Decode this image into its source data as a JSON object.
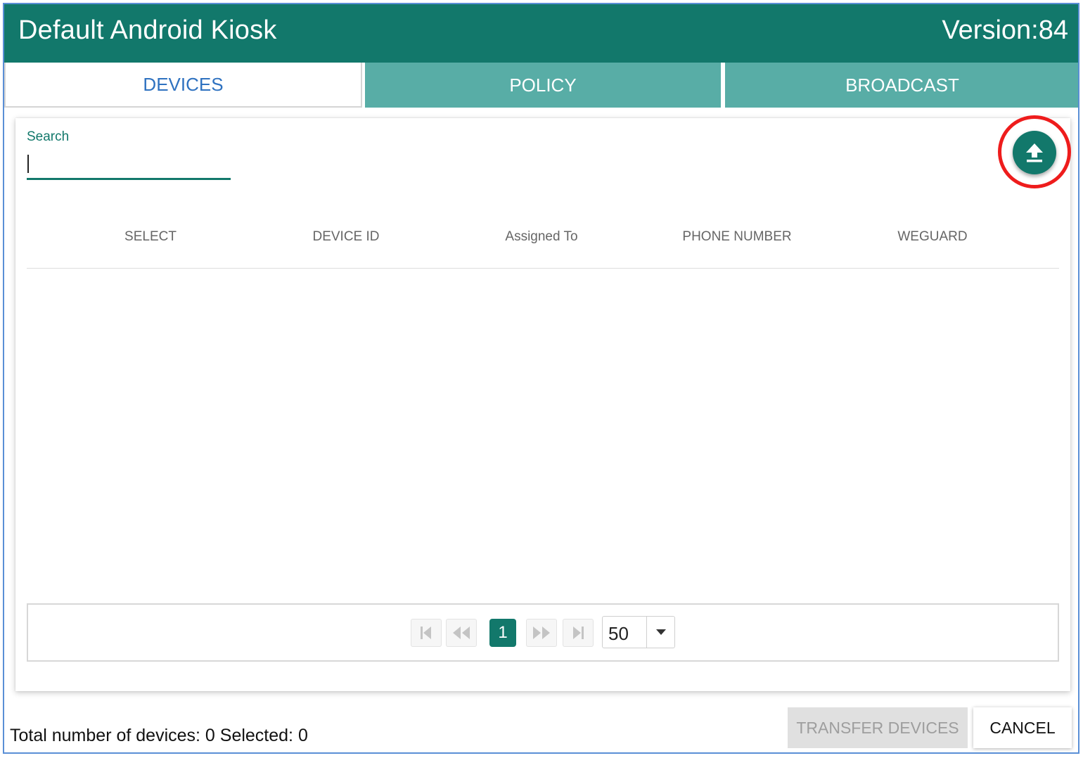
{
  "header": {
    "title": "Default Android Kiosk",
    "version": "Version:84",
    "color": "#12786b"
  },
  "tabs": [
    {
      "label": "DEVICES",
      "active": true
    },
    {
      "label": "POLICY",
      "active": false
    },
    {
      "label": "BROADCAST",
      "active": false
    }
  ],
  "search": {
    "label": "Search",
    "value": "",
    "placeholder": ""
  },
  "upload": {
    "icon": "upload-icon",
    "highlight_color": "#ee1c1c"
  },
  "table": {
    "columns": [
      "SELECT",
      "DEVICE ID",
      "Assigned To",
      "PHONE NUMBER",
      "WEGUARD"
    ],
    "rows": []
  },
  "pagination": {
    "current_page": "1",
    "page_size": "50",
    "icons": [
      "first-page-icon",
      "previous-page-icon",
      "next-page-icon",
      "last-page-icon",
      "caret-down-icon"
    ]
  },
  "footer": {
    "summary": "Total number of devices: 0 Selected: 0",
    "transfer_label": "TRANSFER DEVICES",
    "cancel_label": "CANCEL"
  }
}
